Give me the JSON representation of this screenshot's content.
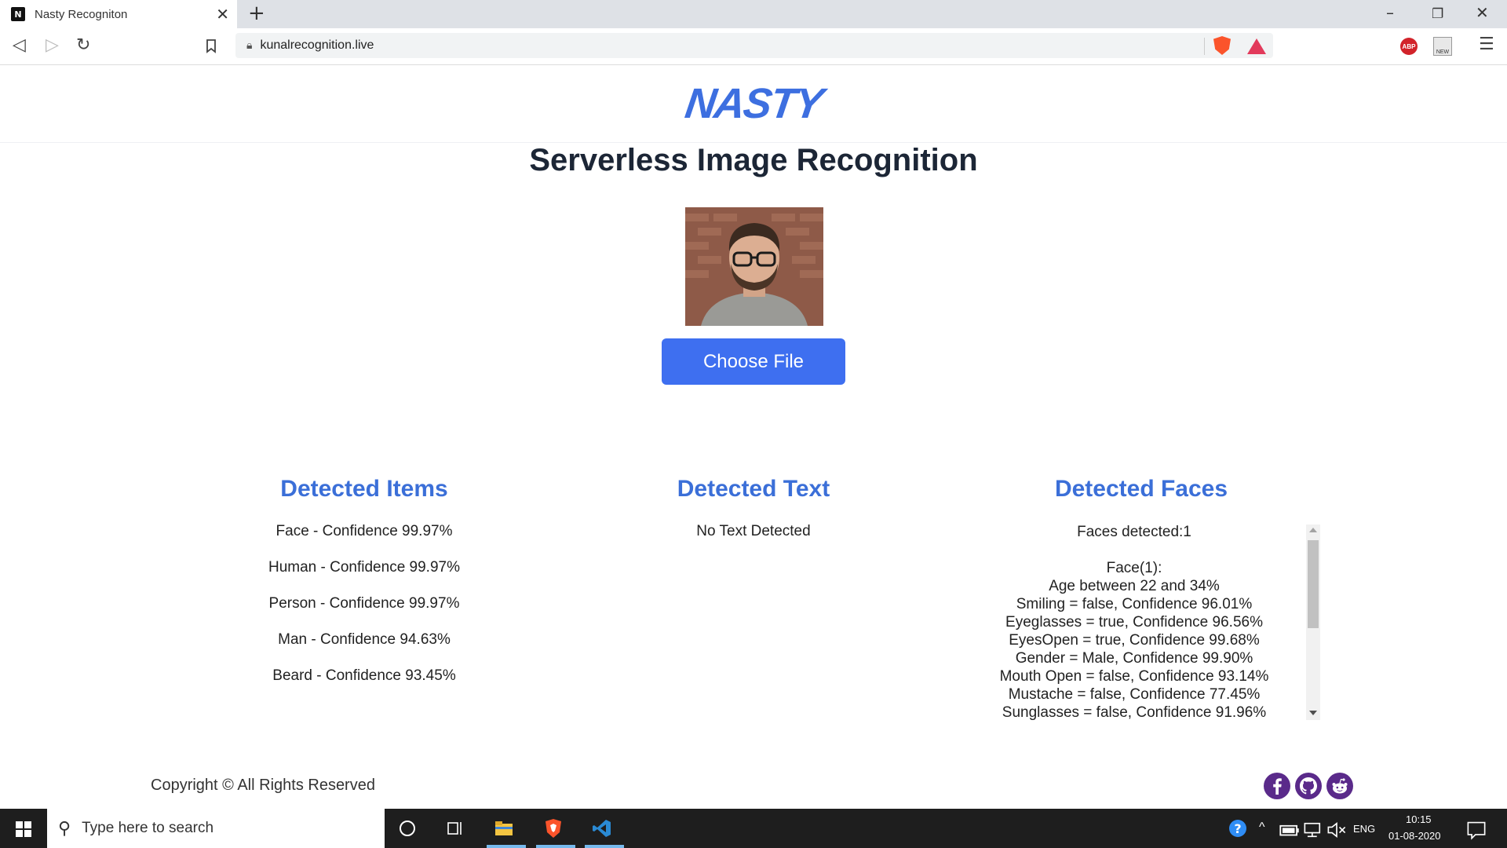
{
  "browser": {
    "tab_title": "Nasty Recogniton",
    "tab_favicon": "N",
    "url": "kunalrecognition.live",
    "ext_abp": "ABP",
    "ext_new": "NEW"
  },
  "site": {
    "logo": "NASTY",
    "title": "Serverless Image Recognition",
    "choose_file": "Choose File"
  },
  "items": {
    "heading": "Detected Items",
    "list": [
      "Face - Confidence 99.97%",
      "Human - Confidence 99.97%",
      "Person - Confidence 99.97%",
      "Man - Confidence 94.63%",
      "Beard - Confidence 93.45%"
    ]
  },
  "text": {
    "heading": "Detected Text",
    "value": "No Text Detected"
  },
  "faces": {
    "heading": "Detected Faces",
    "count": "Faces detected:1",
    "face_title": "Face(1):",
    "attributes": [
      "Age between 22 and 34%",
      "Smiling = false, Confidence 96.01%",
      "Eyeglasses = true, Confidence 96.56%",
      "EyesOpen = true, Confidence 99.68%",
      "Gender = Male, Confidence 99.90%",
      "Mouth Open = false, Confidence 93.14%",
      "Mustache = false, Confidence 77.45%",
      "Sunglasses = false, Confidence 91.96%"
    ]
  },
  "footer": {
    "copyright": "Copyright © All Rights Reserved",
    "social": [
      "facebook-icon",
      "github-icon",
      "reddit-icon"
    ]
  },
  "taskbar": {
    "search_placeholder": "Type here to search",
    "lang": "ENG",
    "time": "10:15",
    "date": "01-08-2020"
  },
  "colors": {
    "accent": "#3e6ff0",
    "heading_blue": "#3b6fd8",
    "social_purple": "#5a2a8a"
  }
}
